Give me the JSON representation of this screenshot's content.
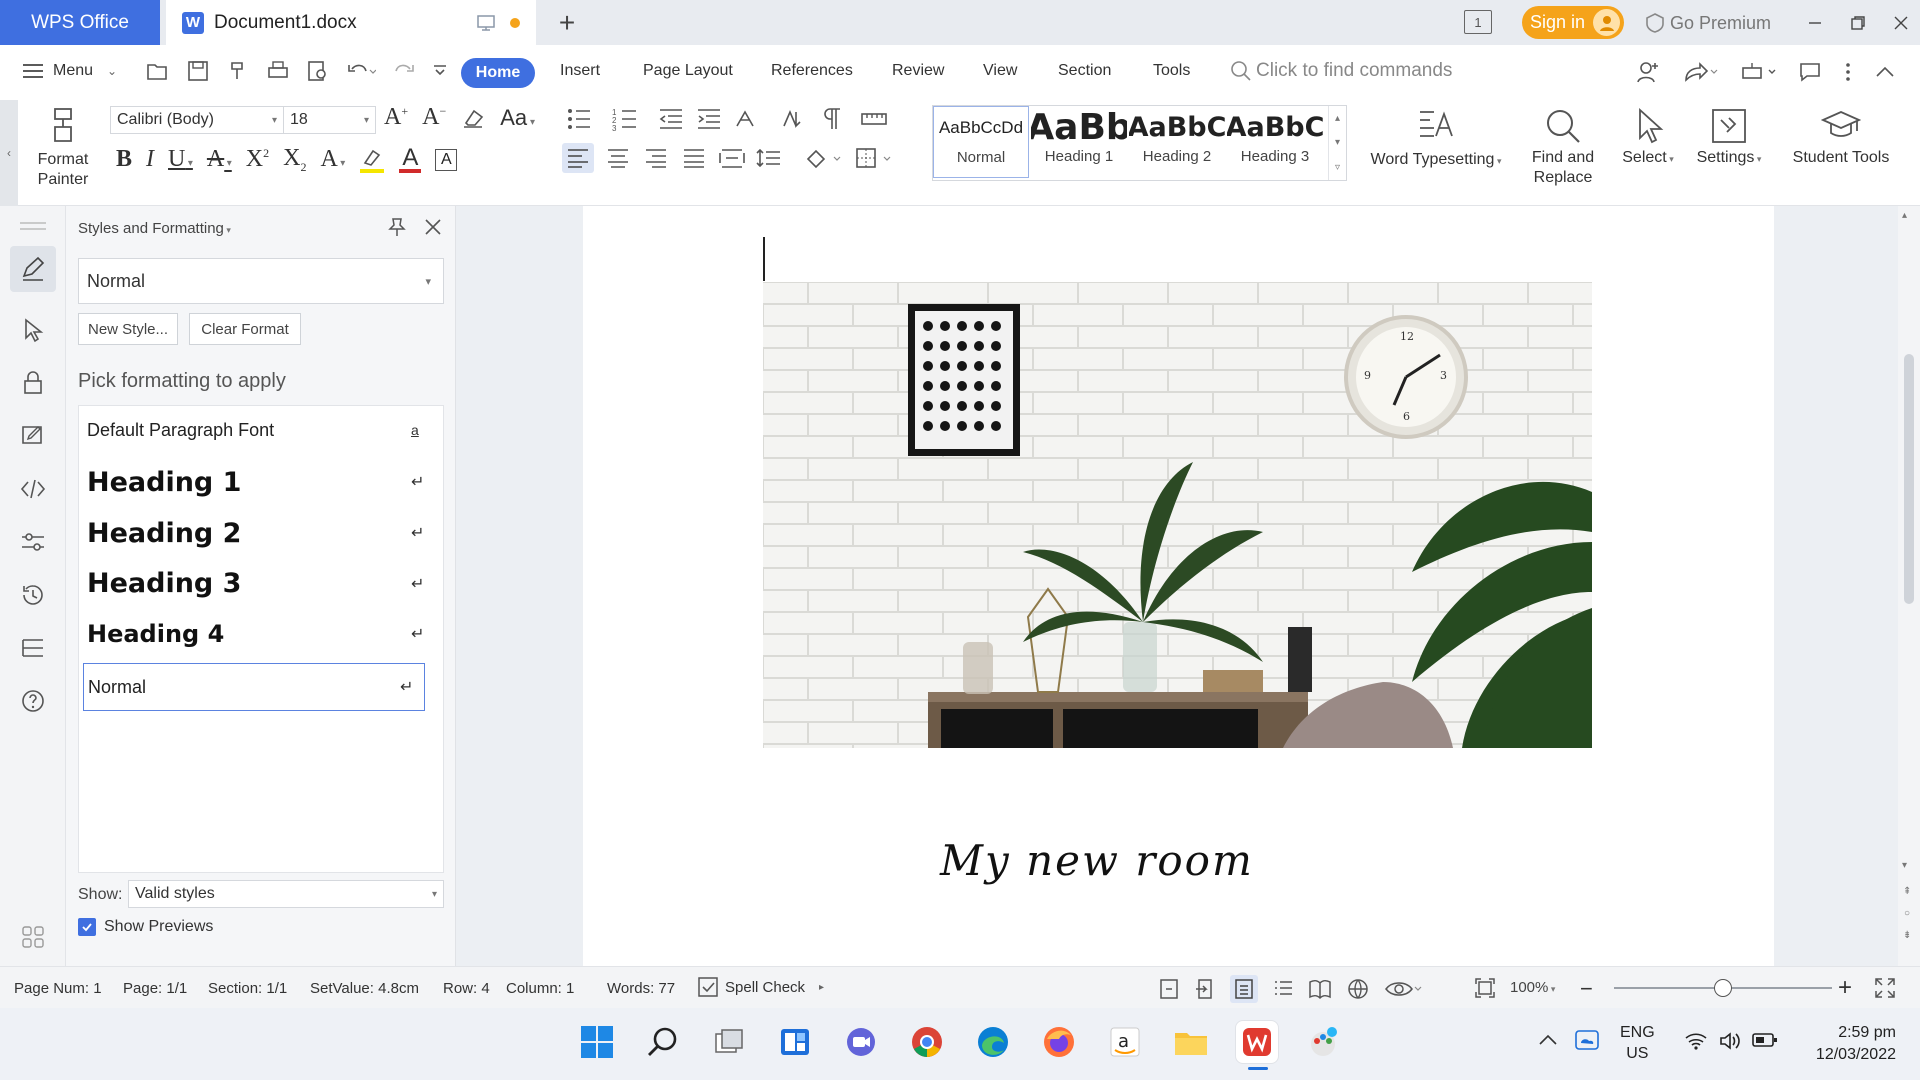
{
  "titlebar": {
    "app_tab": "WPS Office",
    "doc_tab": "Document1.docx",
    "badge_page": "1",
    "sign_in": "Sign in",
    "go_premium": "Go Premium"
  },
  "menubar": {
    "menu_label": "Menu",
    "tabs": [
      "Home",
      "Insert",
      "Page Layout",
      "References",
      "Review",
      "View",
      "Section",
      "Tools"
    ],
    "search_placeholder": "Click to find commands"
  },
  "ribbon": {
    "format_painter": "Format Painter",
    "font_name": "Calibri (Body)",
    "font_size": "18",
    "case_label": "Aa",
    "styles": [
      {
        "preview": "AaBbCcDd",
        "label": "Normal"
      },
      {
        "preview": "AaBb",
        "label": "Heading 1"
      },
      {
        "preview": "AaBbC",
        "label": "Heading 2"
      },
      {
        "preview": "AaBbC",
        "label": "Heading 3"
      }
    ],
    "word_typesetting": "Word Typesetting",
    "find_replace": "Find and Replace",
    "select": "Select",
    "settings": "Settings",
    "student_tools": "Student Tools"
  },
  "panel": {
    "title": "Styles and Formatting",
    "current_style": "Normal",
    "new_style": "New Style...",
    "clear_format": "Clear Format",
    "pick_label": "Pick formatting to apply",
    "items": [
      {
        "name": "Default Paragraph Font",
        "mark": "a"
      },
      {
        "name": "Heading 1",
        "mark": "↵"
      },
      {
        "name": "Heading 2",
        "mark": "↵"
      },
      {
        "name": "Heading 3",
        "mark": "↵"
      },
      {
        "name": "Heading 4",
        "mark": "↵"
      },
      {
        "name": "Normal",
        "mark": "↵"
      }
    ],
    "show_label": "Show:",
    "show_value": "Valid styles",
    "show_previews": "Show Previews",
    "show_previews_checked": true
  },
  "document": {
    "title_text": "My new room"
  },
  "statusbar": {
    "page_num": "Page Num: 1",
    "page": "Page: 1/1",
    "section": "Section: 1/1",
    "set_value": "SetValue: 4.8cm",
    "row": "Row: 4",
    "column": "Column: 1",
    "words": "Words: 77",
    "spell_check": "Spell Check",
    "zoom": "100%",
    "zoom_level": 0.5
  },
  "taskbar": {
    "lang": "ENG",
    "region": "US",
    "time": "2:59 pm",
    "date": "12/03/2022"
  },
  "colors": {
    "accent": "#3f6fe0",
    "signin": "#f5a31a"
  }
}
